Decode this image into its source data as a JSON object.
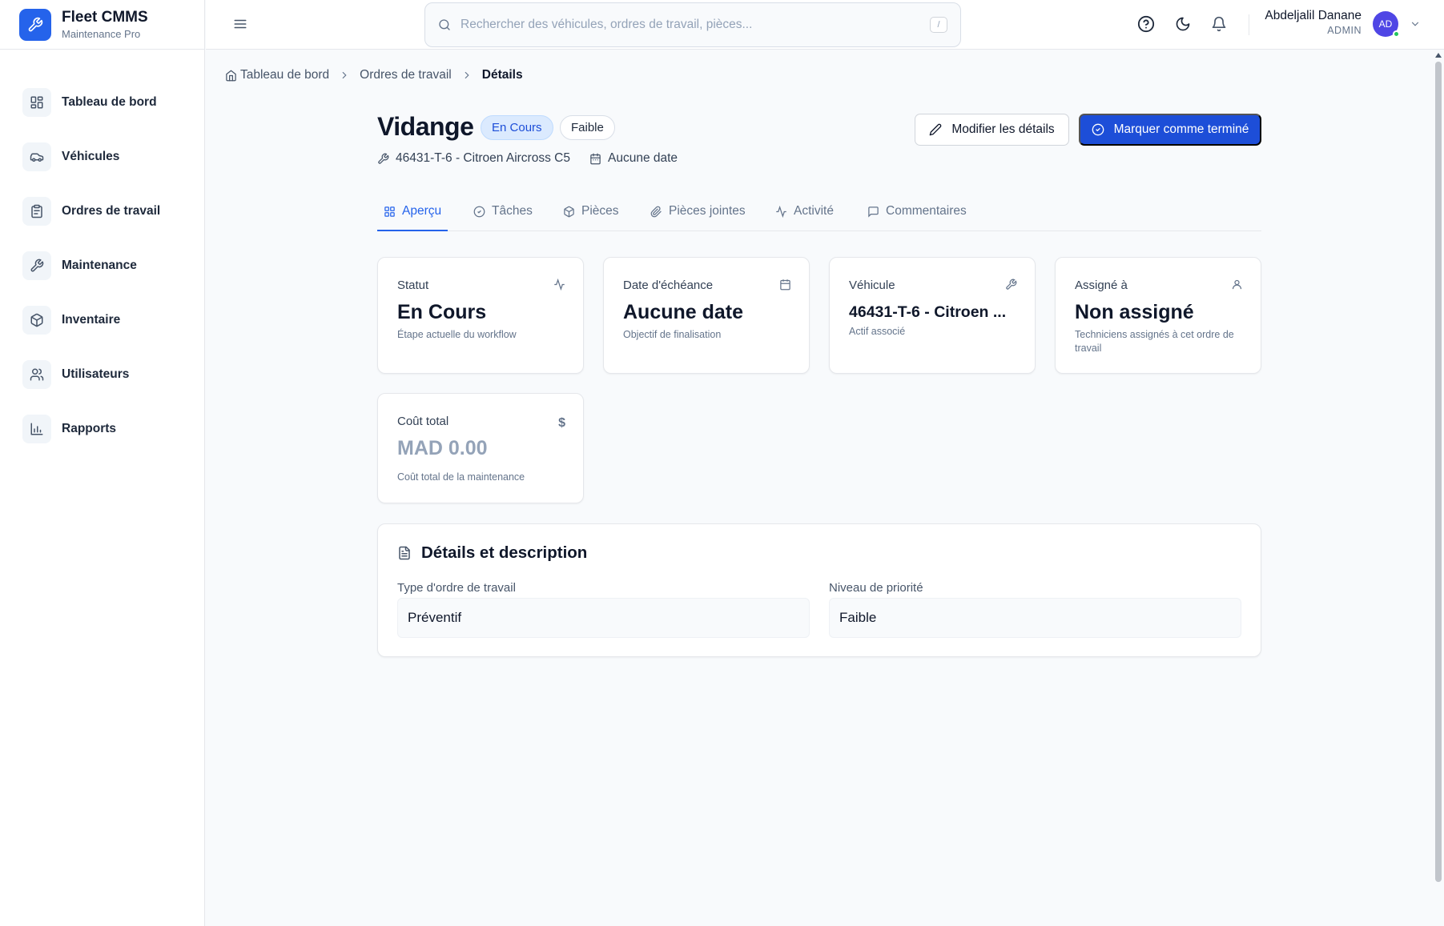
{
  "brand": {
    "name": "Fleet CMMS",
    "subtitle": "Maintenance Pro"
  },
  "sidebar": {
    "items": [
      {
        "label": "Tableau de bord",
        "icon": "dashboard-icon"
      },
      {
        "label": "Véhicules",
        "icon": "car-icon"
      },
      {
        "label": "Ordres de travail",
        "icon": "clipboard-icon"
      },
      {
        "label": "Maintenance",
        "icon": "wrench-icon"
      },
      {
        "label": "Inventaire",
        "icon": "box-icon"
      },
      {
        "label": "Utilisateurs",
        "icon": "users-icon"
      },
      {
        "label": "Rapports",
        "icon": "bar-chart-icon"
      }
    ]
  },
  "search": {
    "placeholder": "Rechercher des véhicules, ordres de travail, pièces...",
    "shortcut": "/"
  },
  "user": {
    "name": "Abdeljalil Danane",
    "role": "ADMIN",
    "initials": "AD"
  },
  "breadcrumb": {
    "home": "Tableau de bord",
    "section": "Ordres de travail",
    "current": "Détails"
  },
  "work_order": {
    "title": "Vidange",
    "status": "En Cours",
    "priority": "Faible",
    "vehicle": "46431-T-6 - Citroen Aircross C5",
    "due_date": "Aucune date"
  },
  "actions": {
    "edit": "Modifier les détails",
    "complete": "Marquer comme terminé"
  },
  "tabs": [
    "Aperçu",
    "Tâches",
    "Pièces",
    "Pièces jointes",
    "Activité",
    "Commentaires"
  ],
  "cards": {
    "status": {
      "label": "Statut",
      "value": "En Cours",
      "sub": "Étape actuelle du workflow"
    },
    "due": {
      "label": "Date d'échéance",
      "value": "Aucune date",
      "sub": "Objectif de finalisation"
    },
    "vehicle": {
      "label": "Véhicule",
      "value": "46431-T-6 - Citroen ...",
      "sub": "Actif associé"
    },
    "assigned": {
      "label": "Assigné à",
      "value": "Non assigné",
      "sub": "Techniciens assignés à cet ordre de travail"
    },
    "cost": {
      "label": "Coût total",
      "icon_text": "$",
      "value": "MAD 0.00",
      "sub": "Coût total de la maintenance"
    }
  },
  "details": {
    "title": "Détails et description",
    "type_label": "Type d'ordre de travail",
    "type_value": "Préventif",
    "priority_label": "Niveau de priorité",
    "priority_value": "Faible"
  },
  "colors": {
    "primary": "#1d4ed8",
    "accent": "#2563eb",
    "status_badge_bg": "#dbeafe",
    "online": "#22c55e"
  }
}
